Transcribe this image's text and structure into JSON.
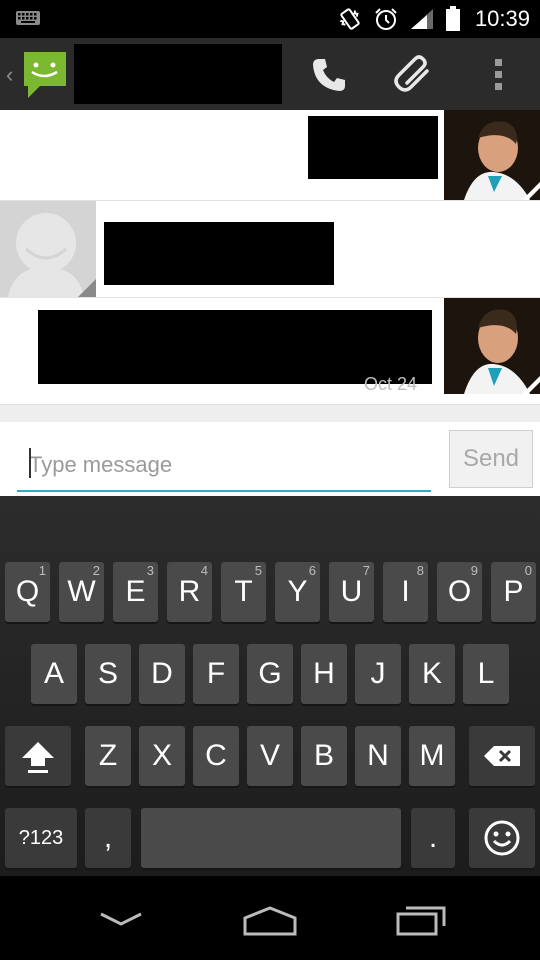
{
  "status_bar": {
    "time": "10:39",
    "icons": [
      "keyboard-icon",
      "vibrate-icon",
      "alarm-icon",
      "signal-icon",
      "battery-icon"
    ]
  },
  "action_bar": {
    "back_glyph": "‹",
    "contact_name_redacted": true,
    "actions": [
      "phone-icon",
      "attach-icon",
      "overflow-menu-icon"
    ]
  },
  "messages": [
    {
      "direction": "outgoing",
      "redacted": true
    },
    {
      "direction": "incoming",
      "redacted": true
    },
    {
      "direction": "outgoing",
      "redacted": true,
      "timestamp": "Oct 24"
    }
  ],
  "compose": {
    "placeholder": "Type message",
    "value": "",
    "send_label": "Send"
  },
  "keyboard": {
    "row1": [
      {
        "label": "Q",
        "hint": "1"
      },
      {
        "label": "W",
        "hint": "2"
      },
      {
        "label": "E",
        "hint": "3"
      },
      {
        "label": "R",
        "hint": "4"
      },
      {
        "label": "T",
        "hint": "5"
      },
      {
        "label": "Y",
        "hint": "6"
      },
      {
        "label": "U",
        "hint": "7"
      },
      {
        "label": "I",
        "hint": "8"
      },
      {
        "label": "O",
        "hint": "9"
      },
      {
        "label": "P",
        "hint": "0"
      }
    ],
    "row2": [
      "A",
      "S",
      "D",
      "F",
      "G",
      "H",
      "J",
      "K",
      "L"
    ],
    "row3": [
      "Z",
      "X",
      "C",
      "V",
      "B",
      "N",
      "M"
    ],
    "symbols_label": "?123",
    "comma_label": ",",
    "period_label": ".",
    "shift_icon": "shift-icon",
    "backspace_icon": "backspace-icon",
    "emoji_icon": "emoji-icon"
  },
  "nav_bar": {
    "buttons": [
      "hide-keyboard-icon",
      "home-icon",
      "recents-icon"
    ]
  },
  "colors": {
    "accent": "#3aa5c8",
    "action_bar": "#2b2b2b",
    "key": "#4a4a4a"
  }
}
